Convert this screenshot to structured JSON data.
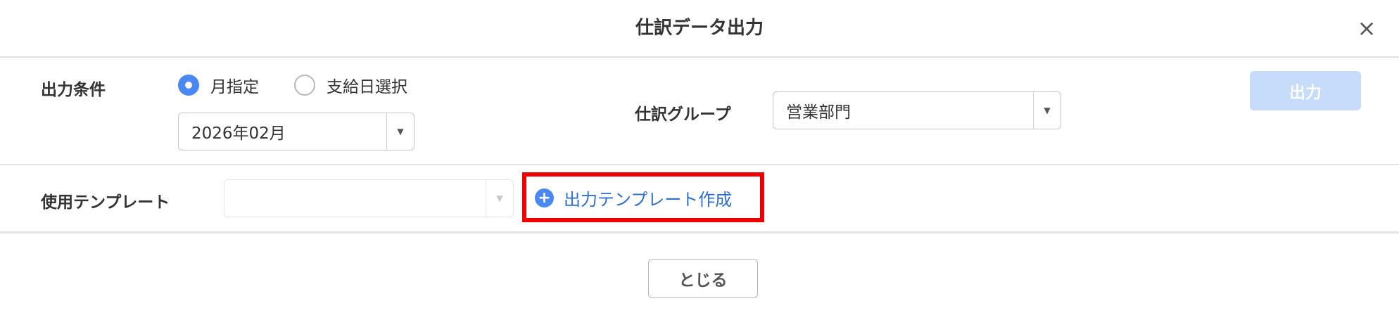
{
  "dialog": {
    "title": "仕訳データ出力"
  },
  "output_condition": {
    "label": "出力条件",
    "radio_month": "月指定",
    "radio_payday": "支給日選択",
    "selected": "月指定",
    "month_value": "2026年02月"
  },
  "journal_group": {
    "label": "仕訳グループ",
    "value": "営業部門"
  },
  "output_button": "出力",
  "template": {
    "label": "使用テンプレート",
    "value": "",
    "create_link": "出力テンプレート作成"
  },
  "footer": {
    "close_button": "とじる"
  },
  "icons": {
    "close": "close-icon",
    "dropdown": "caret-down-icon",
    "add": "plus-circle-icon"
  },
  "colors": {
    "accent": "#4a89f5",
    "link": "#2f6fd0",
    "disabled_button": "#c6dcfa",
    "highlight": "#ee0000"
  }
}
